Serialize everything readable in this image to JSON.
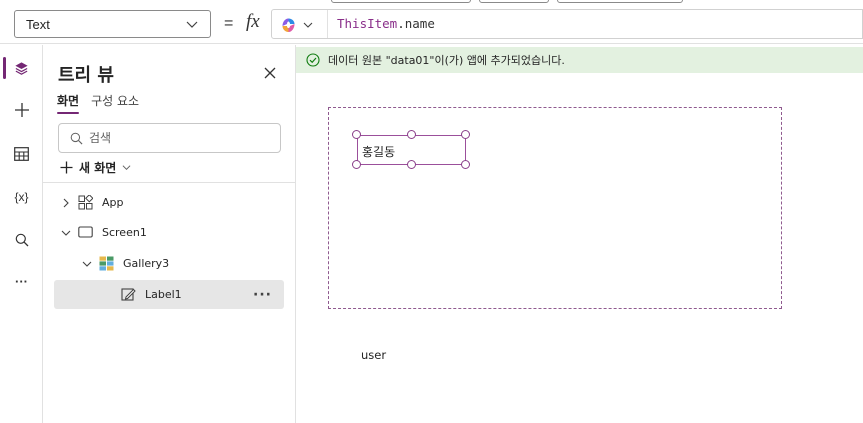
{
  "formula_bar": {
    "property_value": "Text",
    "equals": "=",
    "fx": "fx",
    "formula": {
      "object": "ThisItem",
      "dot": ".",
      "property": "name"
    }
  },
  "rail": {
    "items": [
      {
        "name": "tree-view",
        "icon": "layers-icon",
        "active": true
      },
      {
        "name": "insert",
        "icon": "plus-icon"
      },
      {
        "name": "data",
        "icon": "table-icon"
      },
      {
        "name": "variables",
        "icon": "variables-icon",
        "text": "{x}"
      },
      {
        "name": "search",
        "icon": "search-icon"
      },
      {
        "name": "more",
        "icon": "more-icon",
        "text": "···"
      }
    ]
  },
  "tree_panel": {
    "title": "트리 뷰",
    "tabs": [
      {
        "label": "화면",
        "active": true
      },
      {
        "label": "구성 요소",
        "active": false
      }
    ],
    "search_placeholder": "검색",
    "new_screen_label": "새 화면",
    "nodes": [
      {
        "label": "App",
        "icon": "app-icon",
        "expander": "collapsed",
        "depth": 0
      },
      {
        "label": "Screen1",
        "icon": "screen-icon",
        "expander": "expanded",
        "depth": 0
      },
      {
        "label": "Gallery3",
        "icon": "gallery-icon",
        "expander": "expanded",
        "depth": 1
      },
      {
        "label": "Label1",
        "icon": "label-icon",
        "expander": "none",
        "depth": 2,
        "selected": true,
        "more": "···"
      }
    ]
  },
  "canvas": {
    "notice": "데이터 원본 \"data01\"이(가) 앱에 추가되었습니다.",
    "label_text": "홍길동",
    "below_text": "user"
  },
  "colors": {
    "accent": "#742774",
    "notice_bg": "#e3f1e0",
    "selection_border": "#9b4f9b",
    "formula_keyword": "#8a2f8a"
  }
}
